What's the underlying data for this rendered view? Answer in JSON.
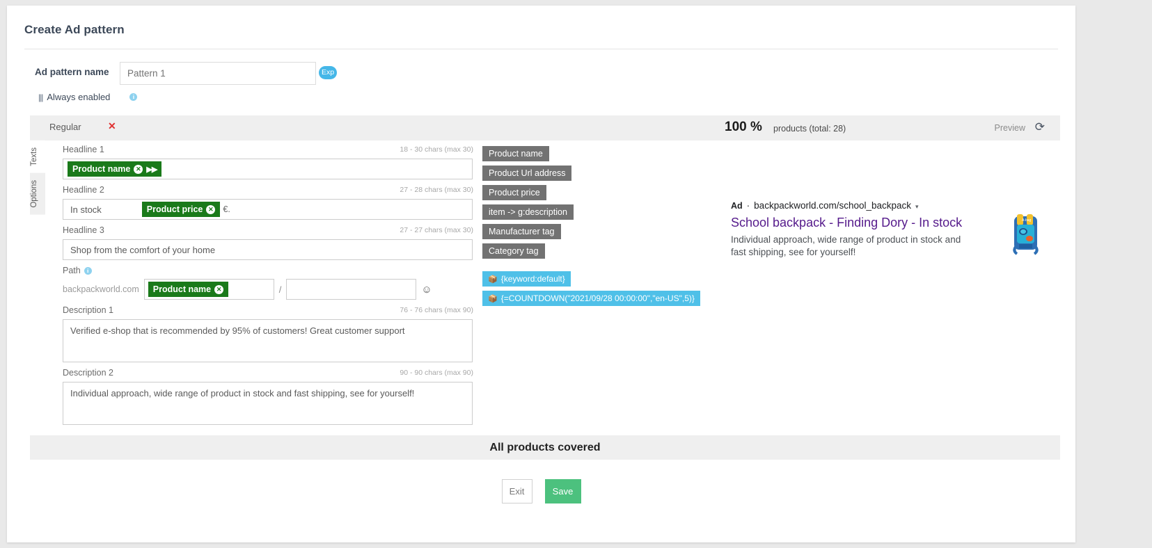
{
  "header": {
    "title": "Create Ad pattern"
  },
  "pattern": {
    "name_label": "Ad pattern name",
    "name_value": "Pattern 1",
    "name_placeholder": "Pattern 1",
    "exp_badge": "Exp",
    "always_enabled": "Always enabled",
    "sliders_icon": "sliders-icon",
    "info_icon": "i"
  },
  "strip": {
    "tab_label": "Regular",
    "close_icon": "✕",
    "percent": "100 %",
    "products_text": "products (total: 28)",
    "preview_label": "Preview",
    "refresh_icon": "⟳"
  },
  "vtabs": [
    {
      "label": "Texts",
      "active": true
    },
    {
      "label": "Options",
      "active": false
    }
  ],
  "fields": {
    "headline1": {
      "label": "Headline 1",
      "count": "18 - 30 chars (max 30)",
      "chip": "Product name",
      "chip_close": "✕",
      "chip_arrows": "▶▶"
    },
    "headline2": {
      "label": "Headline 2",
      "count": "27 - 28 chars (max 30)",
      "text_before": "In stock",
      "chip": "Product price",
      "chip_close": "✕",
      "text_after": "€."
    },
    "headline3": {
      "label": "Headline 3",
      "count": "27 - 27 chars (max 30)",
      "value": "Shop from the comfort of your home"
    },
    "path": {
      "label": "Path",
      "info_icon": "i",
      "domain": "backpackworld.com",
      "chip": "Product name",
      "chip_close": "✕",
      "separator": "/",
      "second_value": "",
      "emoji_icon": "☺"
    },
    "description1": {
      "label": "Description 1",
      "count": "76 - 76 chars (max 90)",
      "value": "Verified e-shop that is recommended by 95% of customers! Great customer support"
    },
    "description2": {
      "label": "Description 2",
      "count": "90 - 90 chars (max 90)",
      "value": "Individual approach, wide range of product in stock and fast shipping, see for yourself!"
    }
  },
  "tag_palette": {
    "grey": [
      "Product name",
      "Product Url address",
      "Product price",
      "item -> g:description",
      "Manufacturer tag",
      "Category tag"
    ],
    "blue": [
      {
        "icon": "📦",
        "label": "{keyword:default}"
      },
      {
        "icon": "📦",
        "label": "{=COUNTDOWN(\"2021/09/28 00:00:00\",\"en-US\",5)}"
      }
    ]
  },
  "ad_preview": {
    "ad_badge": "Ad",
    "separator": "·",
    "url": "backpackworld.com/school_backpack",
    "caret": "▾",
    "title": "School backpack - Finding Dory - In stock",
    "description": "Individual approach, wide range of product in stock and fast shipping, see for yourself!",
    "thumbnail_alt": "product-thumbnail"
  },
  "covered_bar": {
    "text": "All products covered"
  },
  "footer": {
    "exit_label": "Exit",
    "save_label": "Save"
  },
  "colors": {
    "green_chip": "#1a7a1a",
    "grey_tag": "#727272",
    "blue_tag": "#4fc0e8",
    "save_green": "#4cc17e",
    "ad_title_purple": "#551a8b",
    "exp_blue": "#45b7e8",
    "close_red": "#e03131"
  }
}
